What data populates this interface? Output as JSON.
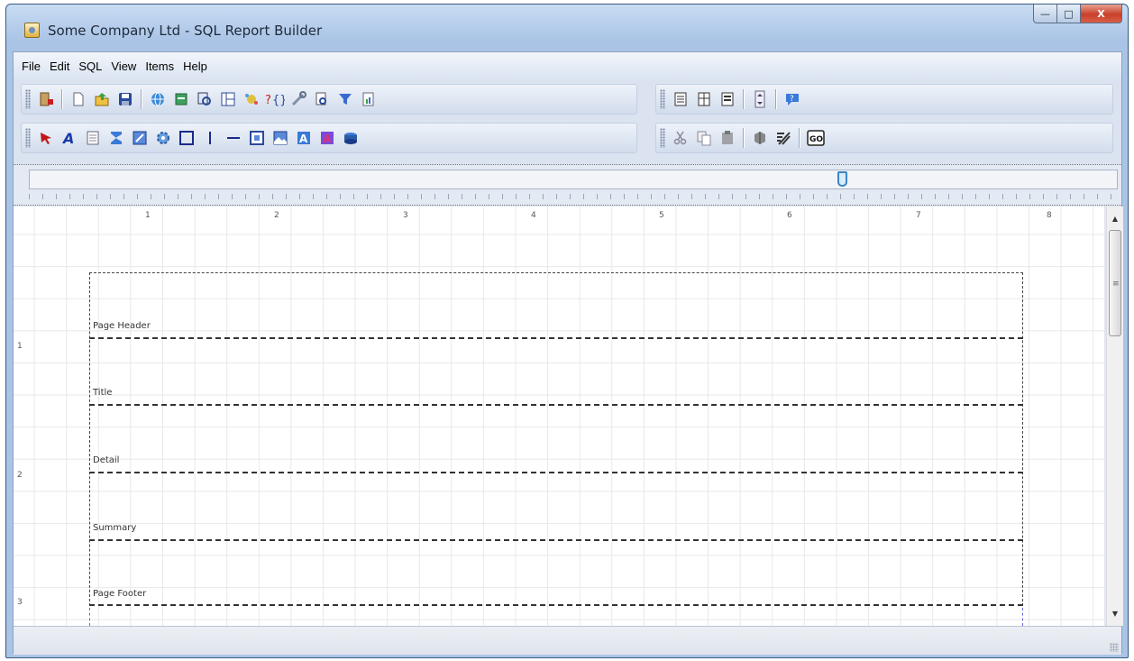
{
  "window": {
    "title": "Some Company Ltd - SQL Report Builder"
  },
  "caption": {
    "minimize": "—",
    "maximize": "□",
    "close": "X"
  },
  "menu": [
    {
      "label": "File"
    },
    {
      "label": "Edit"
    },
    {
      "label": "SQL"
    },
    {
      "label": "View"
    },
    {
      "label": "Items"
    },
    {
      "label": "Help"
    }
  ],
  "toolbar_icons": {
    "row1_left": [
      "exit-icon",
      "new-report-icon",
      "open-report-icon",
      "save-icon",
      "web-icon",
      "database-icon",
      "query-icon",
      "layout-icon",
      "wizard-icon",
      "sql-variables-icon",
      "tools-icon",
      "preview-icon",
      "filter-icon",
      "export-icon"
    ],
    "row1_right": [
      "bands-icon",
      "columns-icon",
      "rows-icon",
      "scroll-icon",
      "help-icon"
    ],
    "row2_left": [
      "pointer-icon",
      "text-icon",
      "memo-icon",
      "sum-icon",
      "formula-icon",
      "gear-icon",
      "rectangle-icon",
      "vertical-line-icon",
      "horizontal-line-icon",
      "image-icon",
      "picture-icon",
      "rich-text-icon",
      "barcode-icon",
      "chart-icon"
    ],
    "row2_right": [
      "cut-icon",
      "copy-icon",
      "paste-icon",
      "group-icon",
      "no-grid-icon",
      "go-icon"
    ]
  },
  "slider": {
    "value_percent": 75
  },
  "ruler": {
    "top": [
      "1",
      "2",
      "3",
      "4",
      "5",
      "6",
      "7",
      "8"
    ],
    "left": [
      "1",
      "2",
      "3"
    ]
  },
  "bands": [
    {
      "label": "Page Header"
    },
    {
      "label": "Title"
    },
    {
      "label": "Detail"
    },
    {
      "label": "Summary"
    },
    {
      "label": "Page Footer"
    }
  ],
  "colors": {
    "accent": "#3b84c4",
    "titlebar": "#aac4e6"
  }
}
